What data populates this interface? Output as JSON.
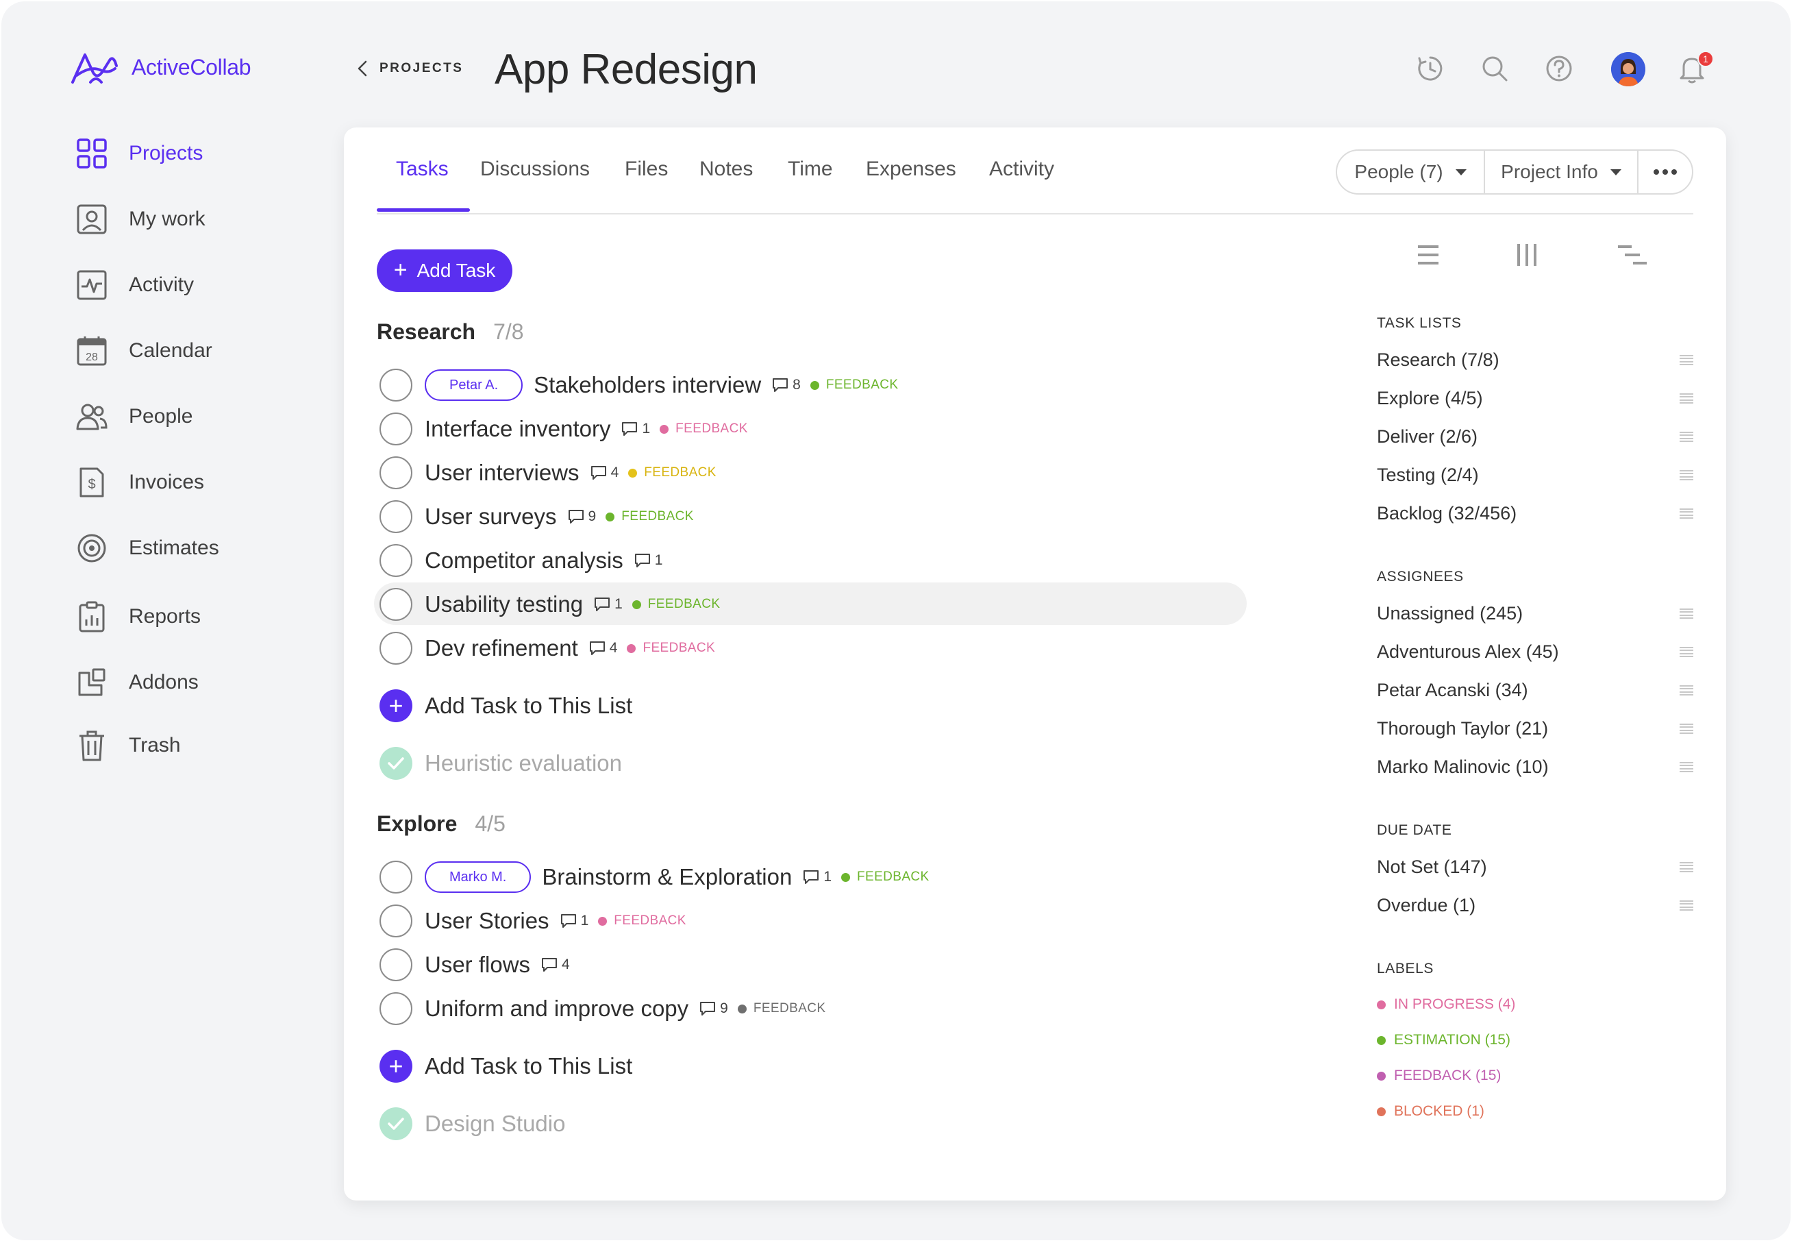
{
  "app": {
    "brand": "ActiveCollab",
    "accent": "#5a2ff0"
  },
  "sidebar": {
    "items": [
      {
        "label": "Projects",
        "icon": "grid-icon"
      },
      {
        "label": "My work",
        "icon": "person-icon"
      },
      {
        "label": "Activity",
        "icon": "activity-icon"
      },
      {
        "label": "Calendar",
        "icon": "calendar-icon",
        "day": "28"
      },
      {
        "label": "People",
        "icon": "people-icon"
      },
      {
        "label": "Invoices",
        "icon": "invoice-icon"
      },
      {
        "label": "Estimates",
        "icon": "target-icon"
      },
      {
        "label": "Reports",
        "icon": "clipboard-chart-icon"
      },
      {
        "label": "Addons",
        "icon": "addons-icon"
      },
      {
        "label": "Trash",
        "icon": "trash-icon"
      }
    ]
  },
  "header": {
    "breadcrumb": "PROJECTS",
    "title": "App Redesign",
    "notification_count": "1"
  },
  "tabs": [
    "Tasks",
    "Discussions",
    "Files",
    "Notes",
    "Time",
    "Expenses",
    "Activity"
  ],
  "toolbar": {
    "people": "People (7)",
    "project_info": "Project Info",
    "add_task": "Add Task"
  },
  "groups": [
    {
      "title": "Research",
      "count": "7/8",
      "tasks": [
        {
          "assignee": "Petar A.",
          "name": "Stakeholders interview",
          "comments": "8",
          "label": "FEEDBACK",
          "label_color": "#6cb52d"
        },
        {
          "name": "Interface inventory",
          "comments": "1",
          "label": "FEEDBACK",
          "label_color": "#e06c9f"
        },
        {
          "name": "User interviews",
          "comments": "4",
          "label": "FEEDBACK",
          "label_color": "#e4c21b"
        },
        {
          "name": "User surveys",
          "comments": "9",
          "label": "FEEDBACK",
          "label_color": "#6cb52d"
        },
        {
          "name": "Competitor analysis",
          "comments": "1"
        },
        {
          "name": "Usability testing",
          "comments": "1",
          "label": "FEEDBACK",
          "label_color": "#6cb52d",
          "highlight": true
        },
        {
          "name": "Dev refinement",
          "comments": "4",
          "label": "FEEDBACK",
          "label_color": "#e06c9f"
        }
      ],
      "add_label": "Add Task to This List",
      "completed": "Heuristic evaluation"
    },
    {
      "title": "Explore",
      "count": "4/5",
      "tasks": [
        {
          "assignee": "Marko M.",
          "name": "Brainstorm & Exploration",
          "comments": "1",
          "label": "FEEDBACK",
          "label_color": "#6cb52d"
        },
        {
          "name": "User Stories",
          "comments": "1",
          "label": "FEEDBACK",
          "label_color": "#e06c9f"
        },
        {
          "name": "User flows",
          "comments": "4"
        },
        {
          "name": "Uniform and improve copy",
          "comments": "9",
          "label": "FEEDBACK",
          "label_color": "#6f6f6f"
        }
      ],
      "add_label": "Add Task to This List",
      "completed": "Design Studio"
    }
  ],
  "panel": {
    "task_lists_head": "TASK LISTS",
    "task_lists": [
      "Research (7/8)",
      "Explore (4/5)",
      "Deliver (2/6)",
      "Testing (2/4)",
      "Backlog (32/456)"
    ],
    "assignees_head": "ASSIGNEES",
    "assignees": [
      "Unassigned (245)",
      "Adventurous Alex (45)",
      "Petar Acanski (34)",
      "Thorough Taylor (21)",
      "Marko Malinovic (10)"
    ],
    "due_head": "DUE DATE",
    "due": [
      "Not Set (147)",
      "Overdue (1)"
    ],
    "labels_head": "LABELS",
    "labels": [
      {
        "text": "IN PROGRESS (4)",
        "color": "#e06c9f"
      },
      {
        "text": "ESTIMATION (15)",
        "color": "#6cb52d"
      },
      {
        "text": "FEEDBACK (15)",
        "color": "#c05fb0"
      },
      {
        "text": "BLOCKED (1)",
        "color": "#e0735a"
      }
    ]
  }
}
